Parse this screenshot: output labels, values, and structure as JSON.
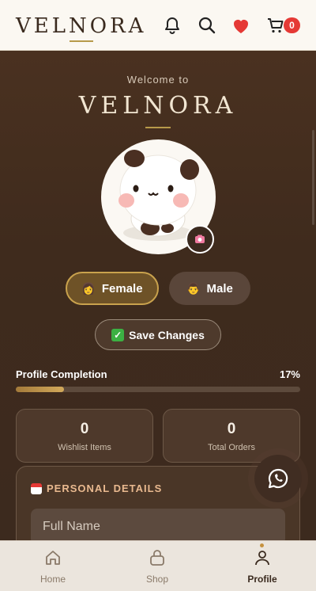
{
  "header": {
    "brand": "VELNORA",
    "cart_count": "0",
    "icons": [
      "bell-icon",
      "search-icon",
      "heart-icon",
      "cart-icon"
    ]
  },
  "hero": {
    "welcome": "Welcome to",
    "brand": "VELNORA"
  },
  "gender": {
    "female_label": "Female",
    "male_label": "Male",
    "selected": "Female"
  },
  "actions": {
    "save_label": "Save Changes"
  },
  "profile": {
    "completion_label": "Profile Completion",
    "completion_value": "17%",
    "completion_fraction": 0.17
  },
  "stats": [
    {
      "value": "0",
      "label": "Wishlist Items"
    },
    {
      "value": "0",
      "label": "Total Orders"
    }
  ],
  "personal": {
    "title": "PERSONAL DETAILS",
    "full_name_placeholder": "Full Name"
  },
  "nav": {
    "home": "Home",
    "shop": "Shop",
    "profile": "Profile",
    "active": "Profile"
  },
  "colors": {
    "primary_bg": "#3f2b1d",
    "accent_gold": "#c9a24d",
    "badge_red": "#e53935"
  }
}
